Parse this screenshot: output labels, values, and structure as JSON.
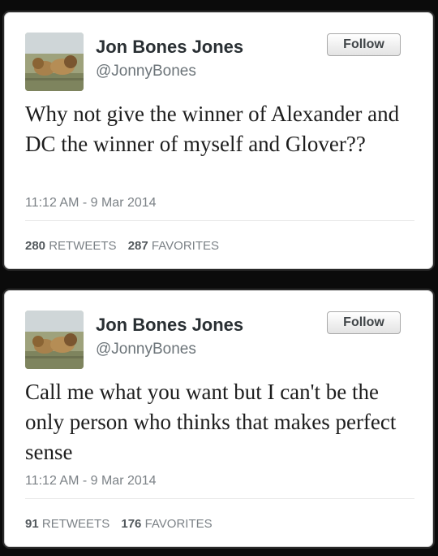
{
  "tweets": [
    {
      "user_name": "Jon Bones Jones",
      "user_handle": "@JonnyBones",
      "follow_label": "Follow",
      "text": "Why not give the winner of Alexander and DC the winner of myself and Glover??",
      "timestamp": "11:12 AM - 9 Mar 2014",
      "retweets_count": "280",
      "retweets_label": "RETWEETS",
      "favorites_count": "287",
      "favorites_label": "FAVORITES"
    },
    {
      "user_name": "Jon Bones Jones",
      "user_handle": "@JonnyBones",
      "follow_label": "Follow",
      "text": "Call me what you want but I can't be the only person who thinks that makes perfect sense",
      "timestamp": "11:12 AM - 9 Mar 2014",
      "retweets_count": "91",
      "retweets_label": "RETWEETS",
      "favorites_count": "176",
      "favorites_label": "FAVORITES"
    }
  ],
  "avatar_icon": "lions-photo"
}
